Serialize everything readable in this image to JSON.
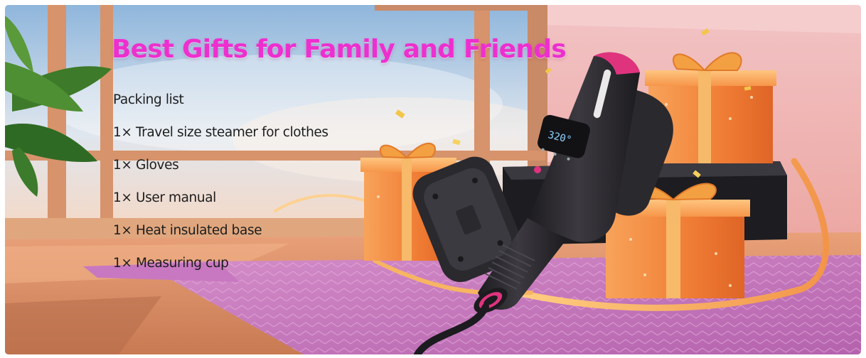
{
  "banner": {
    "headline": "Best Gifts for Family and Friends",
    "packing_title": "Packing list",
    "items": [
      "1× Travel size steamer for clothes",
      "1× Gloves",
      "1× User manual",
      "1× Heat insulated base",
      "1× Measuring cup"
    ],
    "display_readout": "320°"
  },
  "colors": {
    "headline": "#ee2fcf",
    "body_text": "#1d1d1d",
    "rug": "#c272bb",
    "gift_box": "#f07d35",
    "steamer": "#2b2a2e",
    "accent": "#e0337e"
  }
}
